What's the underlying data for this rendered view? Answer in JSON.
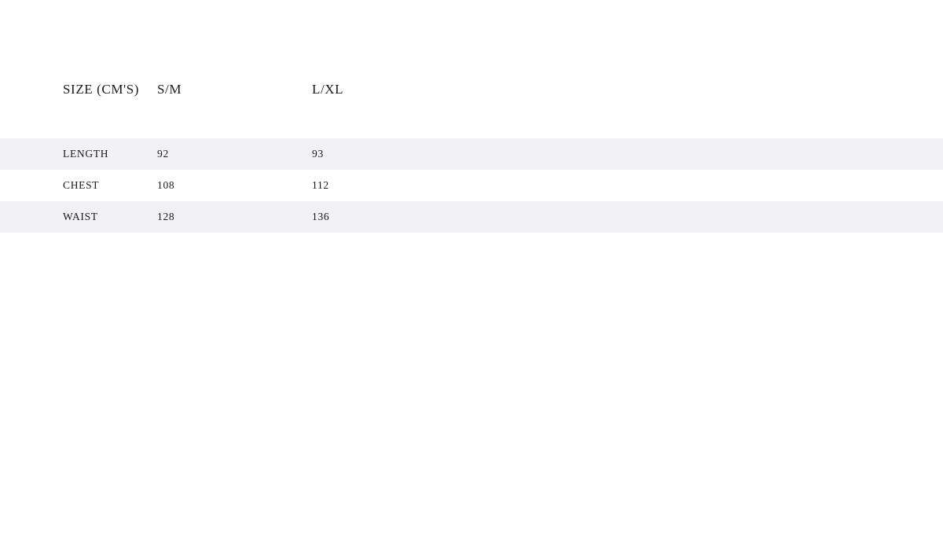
{
  "table": {
    "name": "size-guide",
    "headers": [
      "SIZE (CM'S)",
      "S/M",
      "L/XL"
    ],
    "rows": [
      {
        "label": "LENGTH",
        "sm": "92",
        "lxl": "93"
      },
      {
        "label": "CHEST",
        "sm": "108",
        "lxl": "112"
      },
      {
        "label": "WAIST",
        "sm": "128",
        "lxl": "136"
      }
    ]
  },
  "colors": {
    "page_background": "#ffffff",
    "stripe_background": "#f2f1f6",
    "text": "#1a1a1a"
  }
}
